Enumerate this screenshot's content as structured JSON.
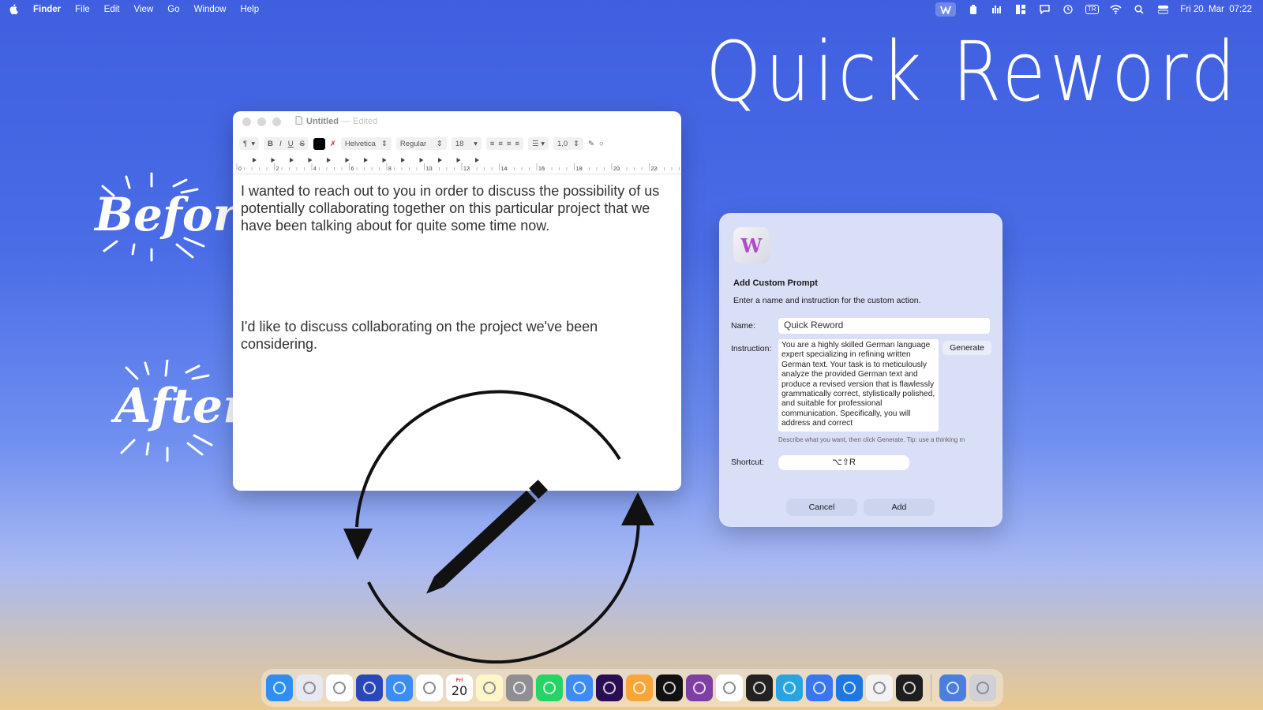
{
  "menubar": {
    "app": "Finder",
    "menus": [
      "File",
      "Edit",
      "View",
      "Go",
      "Window",
      "Help"
    ],
    "clock": "Fri 20. Mar  07:22",
    "status_icons": [
      "w-app-icon",
      "battery-icon",
      "sound-icon",
      "layout-icon",
      "message-icon",
      "clock-icon",
      "tr-input-icon",
      "wifi-icon",
      "search-icon",
      "control-center-icon"
    ],
    "tr_label": "TR"
  },
  "headline": "Quick Reword",
  "labels": {
    "before": "Before",
    "after": "After"
  },
  "textedit": {
    "title": "Untitled",
    "edited": "— Edited",
    "toolbar": {
      "paragraph": "¶",
      "bold": "B",
      "italic": "I",
      "underline": "U",
      "strike": "S",
      "font": "Helvetica",
      "style": "Regular",
      "size": "18",
      "spacing": "1,0"
    },
    "ruler_ticks": [
      "0",
      "2",
      "4",
      "6",
      "8",
      "10",
      "12",
      "14",
      "16",
      "18",
      "20",
      "22"
    ],
    "before_text": "I wanted to reach out to you in order to discuss the possibility of us potentially collaborating together on this particular project that we have been talking about for quite some time now.",
    "after_text": "I'd like to discuss collaborating on the project we've been considering."
  },
  "dialog": {
    "logo_letter": "W",
    "title": "Add Custom Prompt",
    "subtitle": "Enter a name and instruction for the custom action.",
    "name_label": "Name:",
    "name_value": "Quick Reword",
    "instruction_label": "Instruction:",
    "instruction_value": "You are a highly skilled German language expert specializing in refining written German text. Your task is to meticulously analyze the provided German text and produce a revised version that is flawlessly grammatically correct, stylistically polished, and suitable for professional communication. Specifically, you will address and correct",
    "generate_label": "Generate",
    "hint": "Describe what you want, then click Generate. Tip: use a thinking m",
    "shortcut_label": "Shortcut:",
    "shortcut_value": "⌥⇧R",
    "cancel_label": "Cancel",
    "add_label": "Add"
  },
  "dock": {
    "calendar_day": "20",
    "calendar_month": "Fri",
    "apps": [
      {
        "name": "finder",
        "color": "#2f8ff0"
      },
      {
        "name": "launchpad",
        "color": "#e8e8f0"
      },
      {
        "name": "chrome",
        "color": "#ffffff"
      },
      {
        "name": "firefox",
        "color": "#2a47b8"
      },
      {
        "name": "safari",
        "color": "#3b8cf5"
      },
      {
        "name": "photos",
        "color": "#ffffff"
      },
      {
        "name": "calendar",
        "color": "#ffffff"
      },
      {
        "name": "notes",
        "color": "#fff6c8"
      },
      {
        "name": "settings",
        "color": "#8e8e93"
      },
      {
        "name": "whatsapp",
        "color": "#25d366"
      },
      {
        "name": "mail",
        "color": "#3d8bf5"
      },
      {
        "name": "tor",
        "color": "#2a0e52"
      },
      {
        "name": "pages",
        "color": "#f8a53a"
      },
      {
        "name": "spotify",
        "color": "#111111"
      },
      {
        "name": "github-desktop",
        "color": "#7e3fa3"
      },
      {
        "name": "vscode",
        "color": "#ffffff"
      },
      {
        "name": "unity",
        "color": "#222222"
      },
      {
        "name": "telegram",
        "color": "#2aa4e0"
      },
      {
        "name": "signal",
        "color": "#3a76f0"
      },
      {
        "name": "xcode",
        "color": "#1d78e2"
      },
      {
        "name": "textedit",
        "color": "#f2f2f2"
      },
      {
        "name": "terminal",
        "color": "#1e1e1e"
      }
    ],
    "trailing": [
      {
        "name": "downloads",
        "color": "#4a7fe0"
      },
      {
        "name": "trash",
        "color": "#d0d0d6"
      }
    ]
  }
}
